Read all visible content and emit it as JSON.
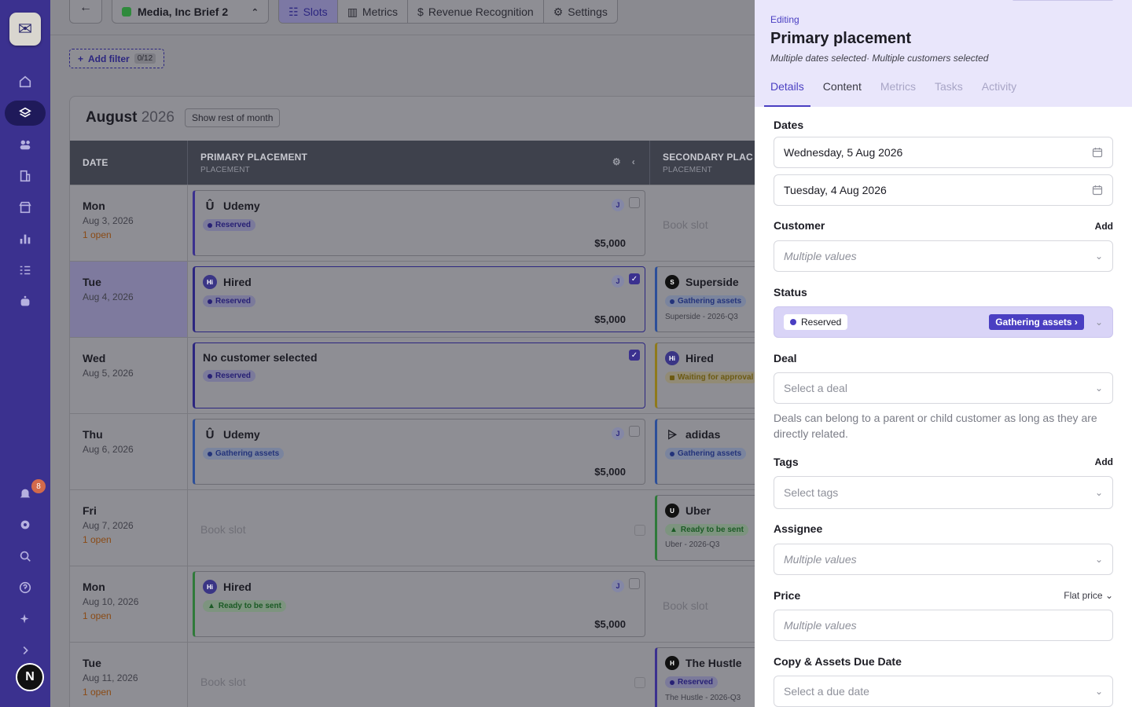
{
  "nav": {
    "notifications_count": "8",
    "user_initial": "N"
  },
  "topbar": {
    "brief_name": "Media, Inc Brief 2",
    "tabs": [
      {
        "label": "Slots",
        "icon": "slots-icon",
        "active": true
      },
      {
        "label": "Metrics",
        "icon": "bar-chart-icon",
        "active": false
      },
      {
        "label": "Revenue Recognition",
        "icon": "dollar-icon",
        "active": false
      },
      {
        "label": "Settings",
        "icon": "gear-icon",
        "active": false
      }
    ],
    "filter_label": "Add filter",
    "filter_count": "0/12"
  },
  "calendar": {
    "month": "August",
    "year": "2026",
    "rest_button": "Show rest of month",
    "columns": {
      "date": "DATE",
      "primary": "PRIMARY PLACEMENT",
      "primary_sub": "PLACEMENT",
      "secondary": "SECONDARY PLAC",
      "secondary_sub": "PLACEMENT"
    },
    "rows": [
      {
        "day": "Mon",
        "date": "Aug 3, 2026",
        "open": "1 open",
        "primary": {
          "name": "Udemy",
          "status": "Reserved",
          "price": "$5,000",
          "assignee": "J"
        },
        "secondary": {
          "book": "Book slot"
        }
      },
      {
        "day": "Tue",
        "date": "Aug 4, 2026",
        "open": "",
        "primary": {
          "name": "Hired",
          "status": "Reserved",
          "price": "$5,000",
          "assignee": "J"
        },
        "secondary": {
          "name": "Superside",
          "status": "Gathering assets",
          "meta": "Superside - 2026-Q3"
        }
      },
      {
        "day": "Wed",
        "date": "Aug 5, 2026",
        "open": "",
        "primary": {
          "name": "No customer selected",
          "status": "Reserved"
        },
        "secondary": {
          "name": "Hired",
          "status": "Waiting for approval"
        }
      },
      {
        "day": "Thu",
        "date": "Aug 6, 2026",
        "open": "",
        "primary": {
          "name": "Udemy",
          "status": "Gathering assets",
          "price": "$5,000",
          "assignee": "J"
        },
        "secondary": {
          "name": "adidas",
          "status": "Gathering assets"
        }
      },
      {
        "day": "Fri",
        "date": "Aug 7, 2026",
        "open": "1 open",
        "primary": {
          "book": "Book slot"
        },
        "secondary": {
          "name": "Uber",
          "status": "Ready to be sent",
          "meta": "Uber - 2026-Q3"
        }
      },
      {
        "day": "Mon",
        "date": "Aug 10, 2026",
        "open": "1 open",
        "primary": {
          "name": "Hired",
          "status": "Ready to be sent",
          "price": "$5,000",
          "assignee": "J"
        },
        "secondary": {
          "book": "Book slot"
        }
      },
      {
        "day": "Tue",
        "date": "Aug 11, 2026",
        "open": "1 open",
        "primary": {
          "book": "Book slot"
        },
        "secondary": {
          "name": "The Hustle",
          "status": "Reserved",
          "meta": "The Hustle - 2026-Q3"
        }
      }
    ]
  },
  "panel": {
    "editing_label": "Editing",
    "title": "Primary placement",
    "subtitle": "Multiple dates selected· Multiple customers selected",
    "tabs": [
      "Details",
      "Content",
      "Metrics",
      "Tasks",
      "Activity"
    ],
    "dates_label": "Dates",
    "date_1": "Wednesday, 5 Aug 2026",
    "date_2": "Tuesday, 4 Aug 2026",
    "customer_label": "Customer",
    "customer_add": "Add",
    "customer_placeholder": "Multiple values",
    "status_label": "Status",
    "status_value": "Reserved",
    "status_next": "Gathering assets",
    "deal_label": "Deal",
    "deal_placeholder": "Select a deal",
    "deal_hint": "Deals can belong to a parent or child customer as long as they are directly related.",
    "tags_label": "Tags",
    "tags_add": "Add",
    "tags_placeholder": "Select tags",
    "assignee_label": "Assignee",
    "assignee_placeholder": "Multiple values",
    "price_label": "Price",
    "price_type": "Flat price",
    "price_placeholder": "Multiple values",
    "due_label": "Copy & Assets Due Date",
    "due_placeholder": "Select a due date"
  },
  "colors": {
    "nav": "#3b318f",
    "accent": "#4a3fc2",
    "panel_header": "#e9e6fb"
  }
}
